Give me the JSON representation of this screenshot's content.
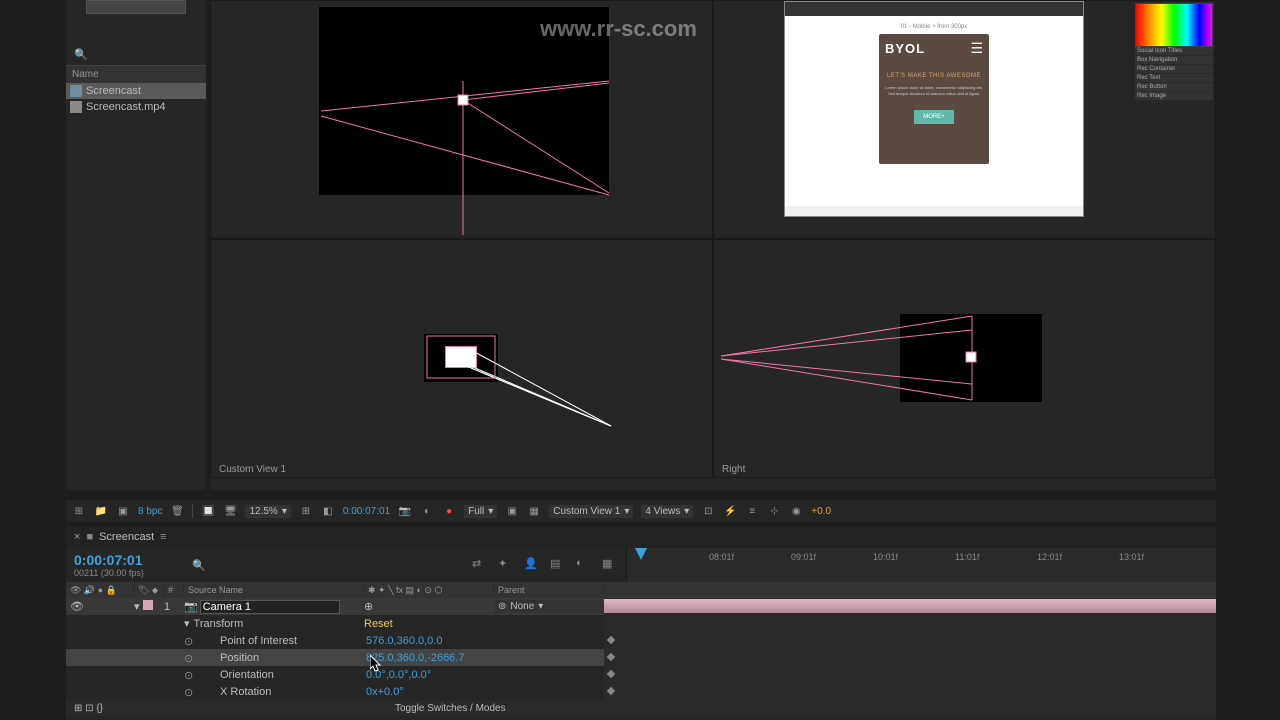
{
  "watermark_url": "www.rr-sc.com",
  "project": {
    "search_placeholder": "",
    "name_header": "Name",
    "items": [
      {
        "name": "Screencast",
        "type": "comp",
        "selected": true
      },
      {
        "name": "Screencast.mp4",
        "type": "footage"
      }
    ]
  },
  "viewports": {
    "custom_view": "Custom View 1",
    "right": "Right"
  },
  "mockup": {
    "header": "01 - Mobile > from 300px",
    "brand": "BYOL",
    "slogan": "LET'S MAKE THIS AWESOME",
    "body": "Lorem ipsum dolor sit amet, consectetur adipiscing elit. Sed tempor tincidunt id ullamcor tellus velit at ligula.",
    "button": "MORE+"
  },
  "swatches": [
    "Social Icon Titles",
    "Box Navigation",
    "Rec Container",
    "Rec Text",
    "Rec Button",
    "Rec Image"
  ],
  "footer": {
    "bpc": "8 bpc",
    "zoom": "12.5%",
    "timecode": "0:00:07:01",
    "resolution": "Full",
    "view_mode": "Custom View 1",
    "views": "4 Views",
    "exposure": "+0.0"
  },
  "timeline": {
    "tab": "Screencast",
    "timecode": "0:00:07:01",
    "frame_info": "00211 (30.00 fps)",
    "col_num": "#",
    "col_source": "Source Name",
    "col_parent": "Parent",
    "ruler": [
      "08:01f",
      "09:01f",
      "10:01f",
      "11:01f",
      "12:01f",
      "13:01f"
    ],
    "layer": {
      "num": "1",
      "name": "Camera 1",
      "parent": "None"
    },
    "transform": "Transform",
    "reset": "Reset",
    "props": [
      {
        "label": "Point of Interest",
        "value": "576.0,360.0,0.0"
      },
      {
        "label": "Position",
        "value": "825.0,360.0,-2666.7",
        "selected": true
      },
      {
        "label": "Orientation",
        "value": "0.0°,0.0°,0.0°"
      },
      {
        "label": "X Rotation",
        "value": "0x+0.0°"
      }
    ],
    "toggle": "Toggle Switches / Modes"
  }
}
